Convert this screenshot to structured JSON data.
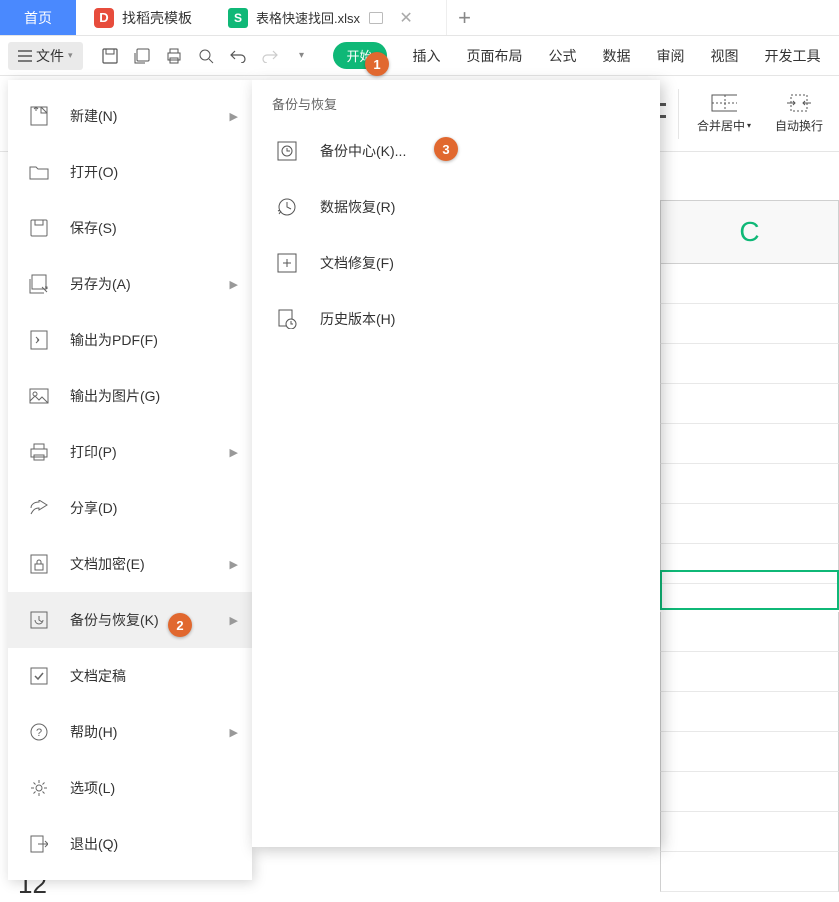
{
  "tabs": {
    "home": "首页",
    "templates": "找稻壳模板",
    "doc_title": "表格快速找回.xlsx"
  },
  "toolbar": {
    "file_label": "文件"
  },
  "ribbon_tabs": {
    "start": "开始",
    "insert": "插入",
    "page_layout": "页面布局",
    "formula": "公式",
    "data": "数据",
    "review": "审阅",
    "view": "视图",
    "dev": "开发工具"
  },
  "ribbon_items": {
    "merge_center": "合并居中",
    "auto_wrap": "自动换行"
  },
  "file_menu": {
    "new": "新建(N)",
    "open": "打开(O)",
    "save": "保存(S)",
    "save_as": "另存为(A)",
    "export_pdf": "输出为PDF(F)",
    "export_img": "输出为图片(G)",
    "print": "打印(P)",
    "share": "分享(D)",
    "encrypt": "文档加密(E)",
    "backup_restore": "备份与恢复(K)",
    "finalize": "文档定稿",
    "help": "帮助(H)",
    "options": "选项(L)",
    "exit": "退出(Q)"
  },
  "submenu": {
    "header": "备份与恢复",
    "backup_center": "备份中心(K)...",
    "data_recovery": "数据恢复(R)",
    "doc_repair": "文档修复(F)",
    "history": "历史版本(H)"
  },
  "badges": {
    "b1": "1",
    "b2": "2",
    "b3": "3"
  },
  "grid": {
    "col_c": "C",
    "row12": "12"
  }
}
